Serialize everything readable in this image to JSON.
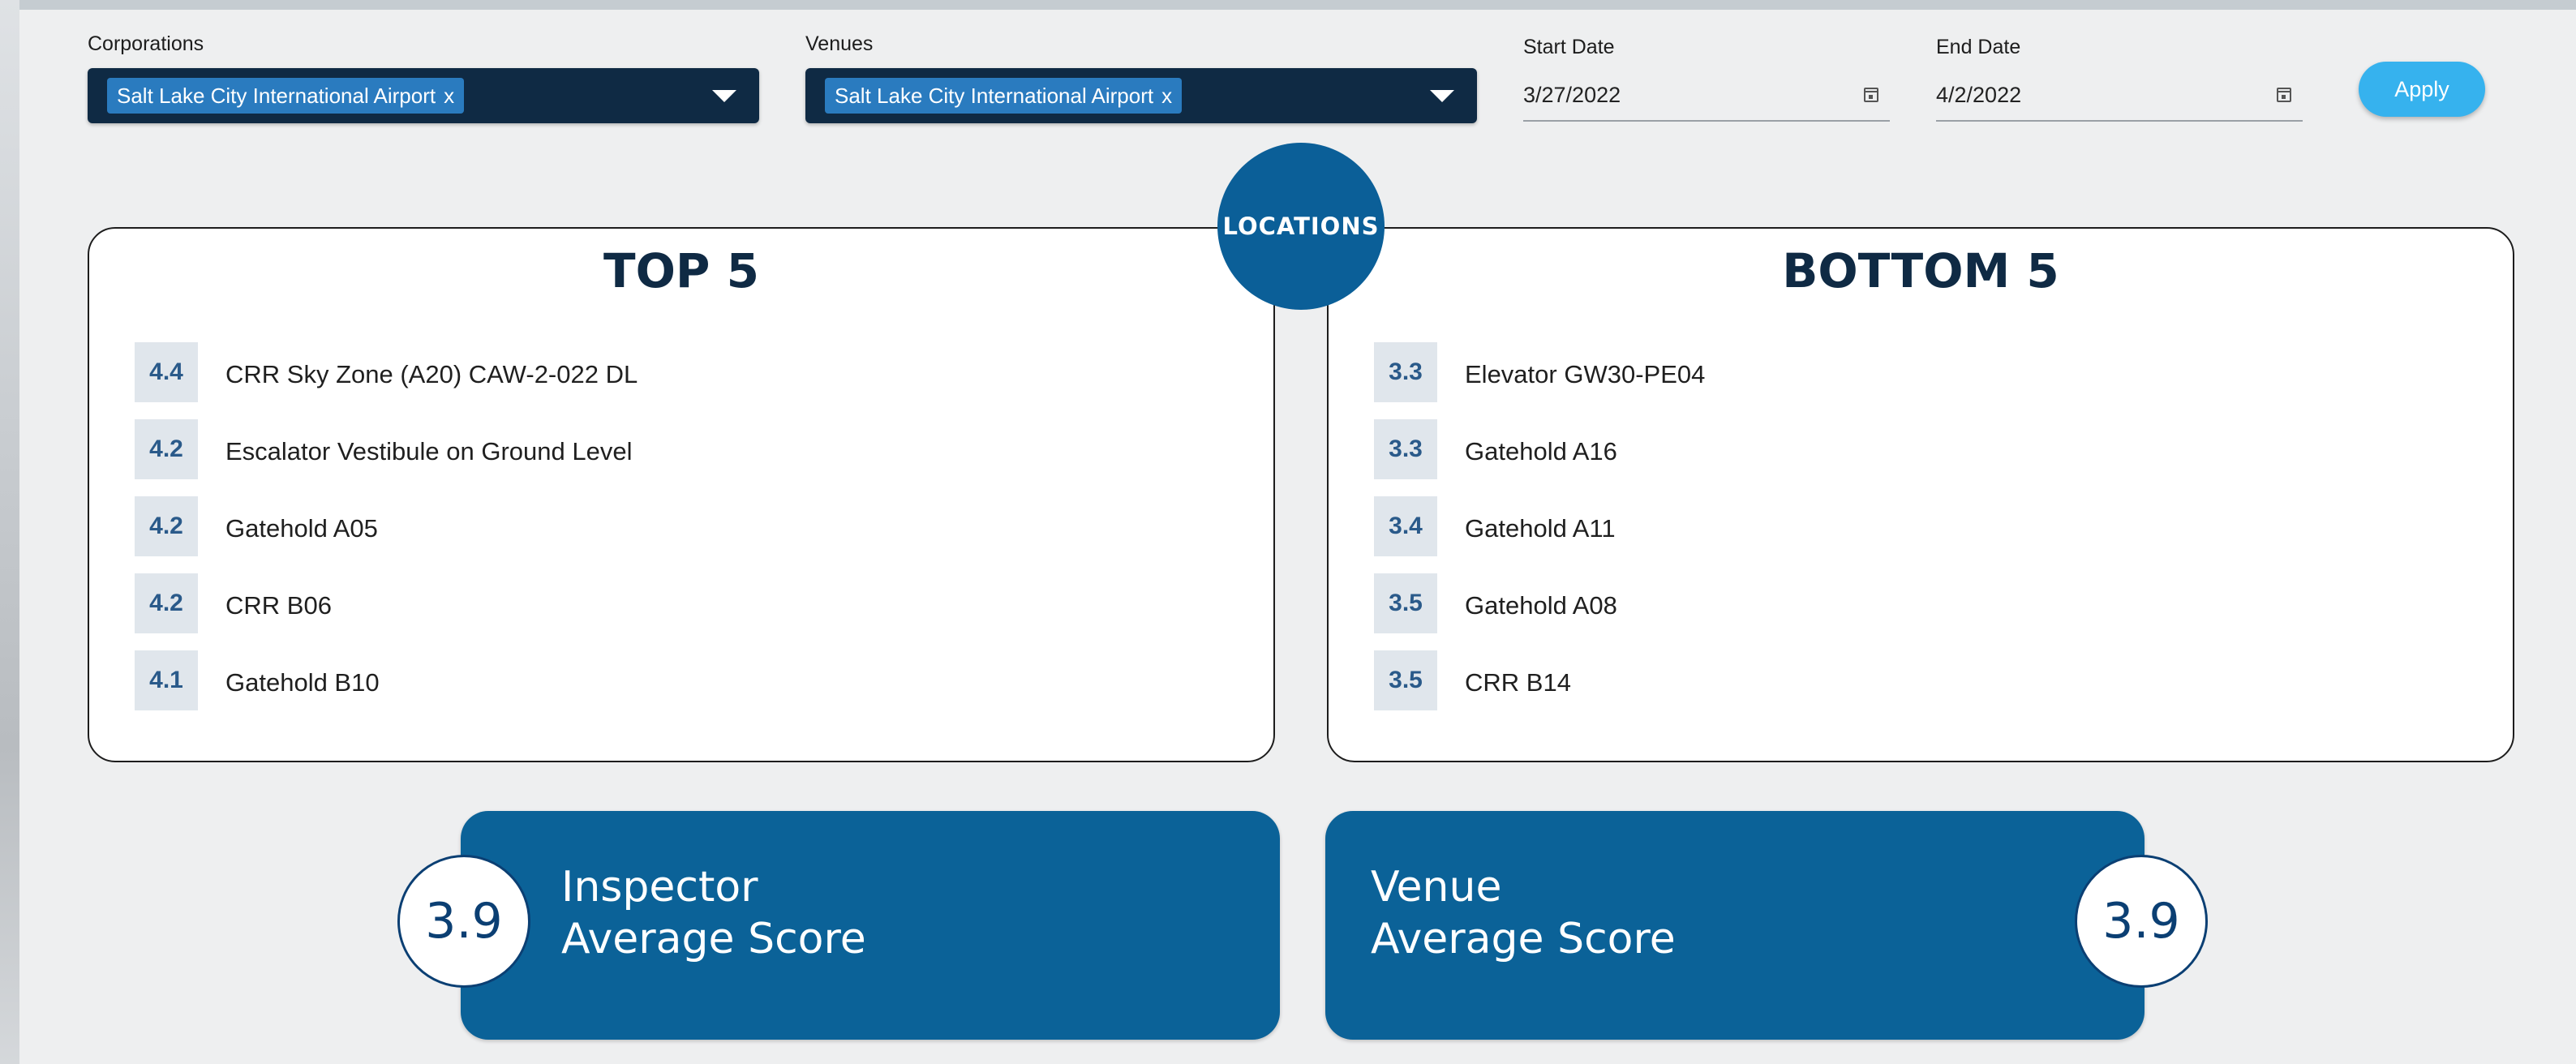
{
  "filters": {
    "corporations": {
      "label": "Corporations",
      "selected": "Salt Lake City International Airport",
      "remove": "x"
    },
    "venues": {
      "label": "Venues",
      "selected": "Salt Lake City International Airport",
      "remove": "x"
    },
    "start_date": {
      "label": "Start Date",
      "value": "3/27/2022"
    },
    "end_date": {
      "label": "End Date",
      "value": "4/2/2022"
    },
    "apply_label": "Apply"
  },
  "locations_label": "LOCATIONS",
  "top5": {
    "title": "TOP 5",
    "items": [
      {
        "score": "4.4",
        "name": "CRR Sky Zone (A20) CAW-2-022 DL"
      },
      {
        "score": "4.2",
        "name": "Escalator Vestibule on Ground Level"
      },
      {
        "score": "4.2",
        "name": "Gatehold A05"
      },
      {
        "score": "4.2",
        "name": "CRR B06"
      },
      {
        "score": "4.1",
        "name": "Gatehold B10"
      }
    ]
  },
  "bottom5": {
    "title": "BOTTOM 5",
    "items": [
      {
        "score": "3.3",
        "name": "Elevator GW30-PE04"
      },
      {
        "score": "3.3",
        "name": "Gatehold A16"
      },
      {
        "score": "3.4",
        "name": "Gatehold A11"
      },
      {
        "score": "3.5",
        "name": "Gatehold A08"
      },
      {
        "score": "3.5",
        "name": "CRR B14"
      }
    ]
  },
  "inspector": {
    "score": "3.9",
    "line1": "Inspector",
    "line2": "Average Score"
  },
  "venue": {
    "score": "3.9",
    "line1": "Venue",
    "line2": "Average Score"
  },
  "colors": {
    "navy": "#0f2a44",
    "chip_blue": "#2a7bbf",
    "apply_blue": "#36b2ee",
    "card_blue": "#0b6298",
    "badge_blue": "#0b5f98"
  }
}
